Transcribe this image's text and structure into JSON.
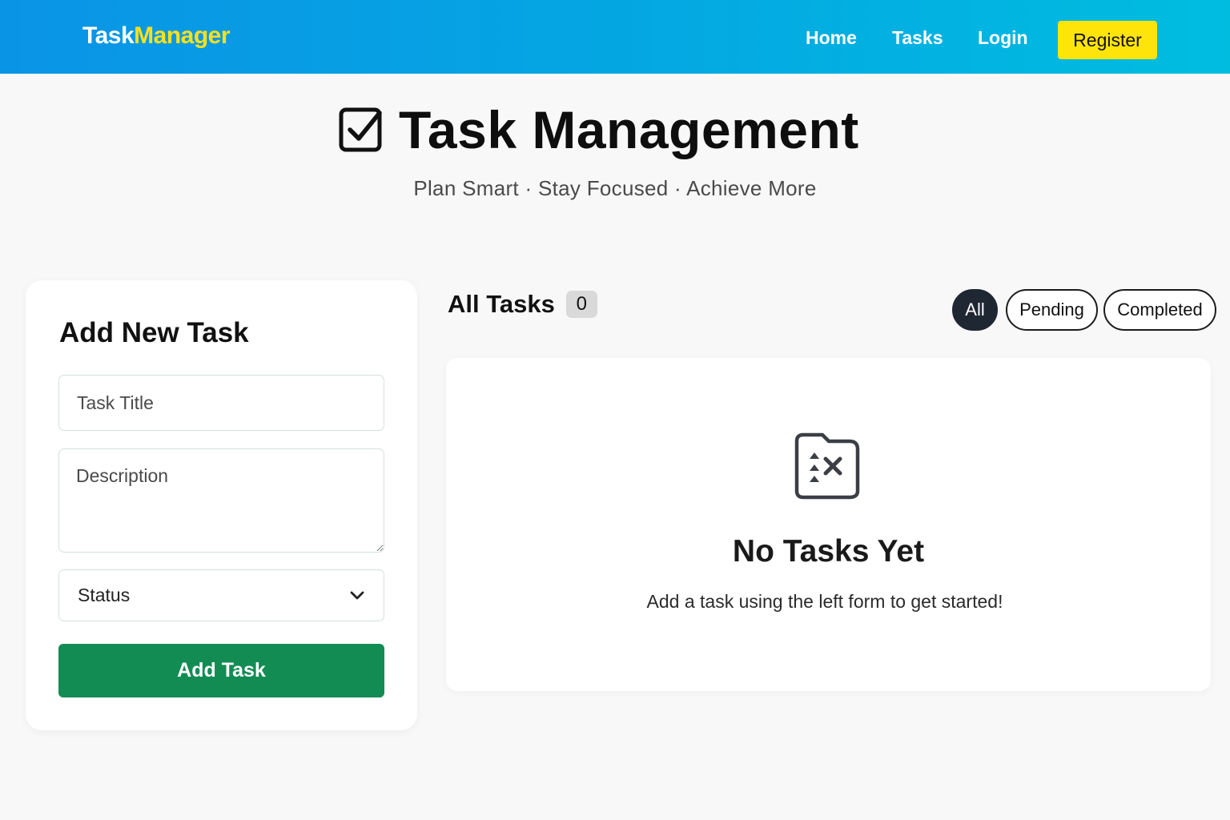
{
  "navbar": {
    "brand_part1": "Task",
    "brand_part2": "Manager",
    "links": [
      "Home",
      "Tasks",
      "Login"
    ],
    "register_label": "Register"
  },
  "hero": {
    "title": "Task Management",
    "subtitle": "Plan Smart · Stay Focused · Achieve More",
    "icon": "checkbox-icon"
  },
  "form": {
    "title": "Add New Task",
    "title_placeholder": "Task Title",
    "description_placeholder": "Description",
    "status_label": "Status",
    "submit_label": "Add Task"
  },
  "tasks": {
    "heading": "All Tasks",
    "count": "0",
    "filters": [
      "All",
      "Pending",
      "Completed"
    ],
    "active_filter": "All"
  },
  "empty_state": {
    "icon": "empty-tasks-icon",
    "title": "No Tasks Yet",
    "message": "Add a task using the left form to get started!"
  },
  "colors": {
    "nav_gradient_start": "#0a94e6",
    "nav_gradient_end": "#00bde0",
    "brand_accent": "#ffe01a",
    "register_bg": "#ffe40a",
    "add_button": "#138c54",
    "active_filter_bg": "#1f2733"
  }
}
